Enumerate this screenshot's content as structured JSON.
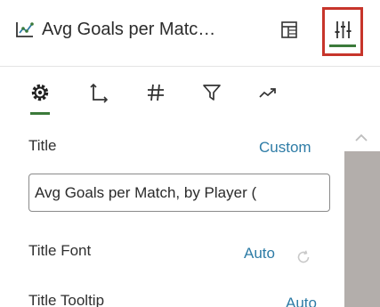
{
  "header": {
    "chart_title": "Avg Goals per Matc…",
    "chart_icon": "line-chart-icon",
    "panel_icon": "panel-layout-icon",
    "properties_icon": "sliders-icon"
  },
  "tabs": [
    {
      "icon": "gear-icon",
      "active": true
    },
    {
      "icon": "axis-icon",
      "active": false
    },
    {
      "icon": "number-format-icon",
      "active": false
    },
    {
      "icon": "filter-icon",
      "active": false
    },
    {
      "icon": "analytics-icon",
      "active": false
    }
  ],
  "properties": {
    "title": {
      "label": "Title",
      "value": "Custom",
      "input_value": "Avg Goals per Match, by Player ("
    },
    "title_font": {
      "label": "Title Font",
      "value": "Auto",
      "icon": "reset-icon"
    },
    "title_tooltip": {
      "label": "Title Tooltip",
      "value": "Auto"
    }
  },
  "colors": {
    "accent_green": "#3b7a3a",
    "highlight_red": "#c7352b",
    "link_blue": "#2e7ca6",
    "scroll_thumb": "#b3aeab"
  }
}
